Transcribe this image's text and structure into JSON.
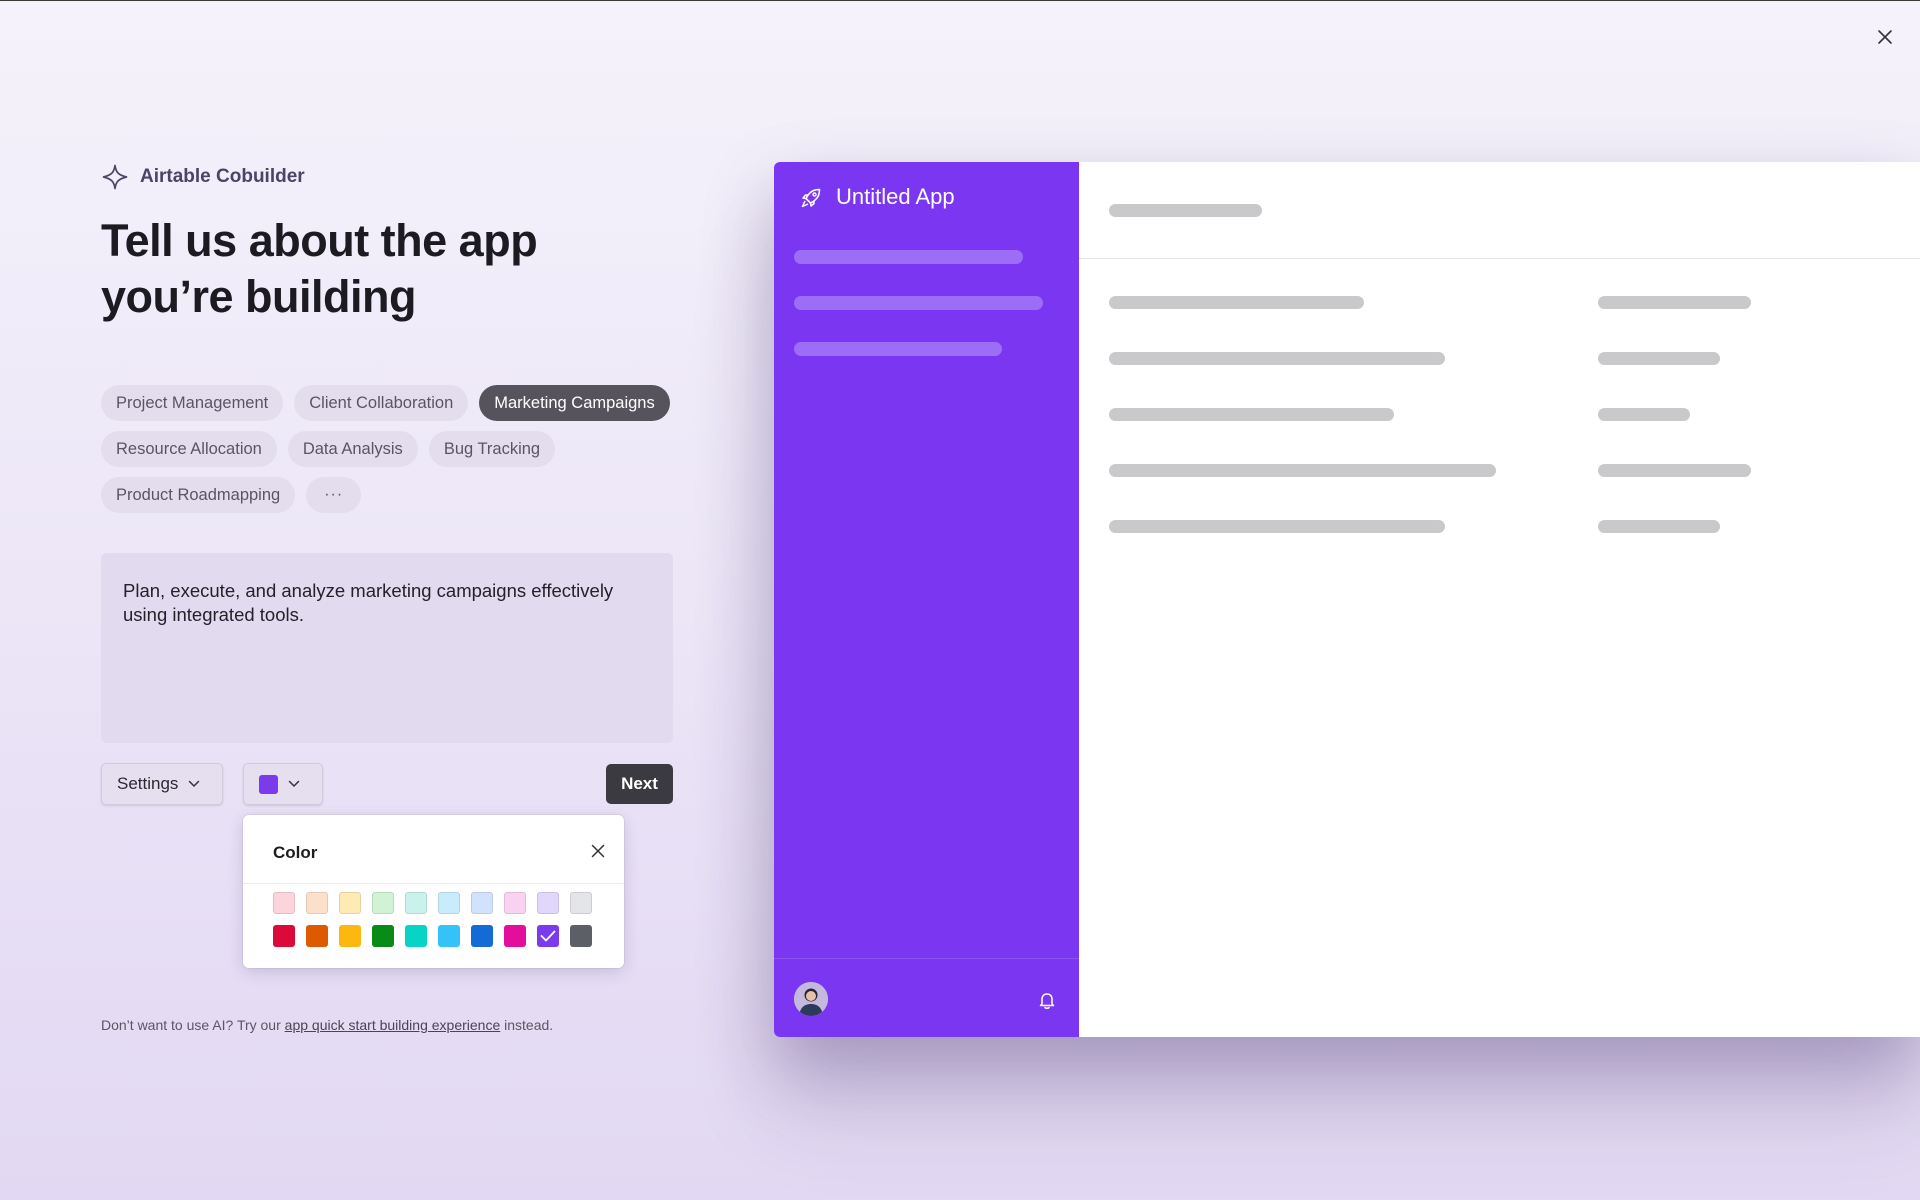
{
  "brand": {
    "label": "Airtable Cobuilder",
    "icon": "sparkle-icon"
  },
  "headline": {
    "line1": "Tell us about the app",
    "line2": "you’re building"
  },
  "chips": [
    {
      "label": "Project Management",
      "selected": false
    },
    {
      "label": "Client Collaboration",
      "selected": false
    },
    {
      "label": "Marketing Campaigns",
      "selected": true
    },
    {
      "label": "Resource Allocation",
      "selected": false
    },
    {
      "label": "Data Analysis",
      "selected": false
    },
    {
      "label": "Bug Tracking",
      "selected": false
    },
    {
      "label": "Product Roadmapping",
      "selected": false
    },
    {
      "label": "···",
      "selected": false
    }
  ],
  "prompt": {
    "value": "Plan, execute, and analyze marketing campaigns effectively using integrated tools."
  },
  "controls": {
    "settings_label": "Settings",
    "selected_color": "#7c3aed",
    "next_label": "Next"
  },
  "color_popover": {
    "title": "Color",
    "light_colors": [
      "#fcd5dc",
      "#fde0cc",
      "#fdeab5",
      "#d1f2d4",
      "#c9f2ec",
      "#c8ecfb",
      "#d3e2fb",
      "#f9d2f1",
      "#e1d6fb",
      "#e4e5e8"
    ],
    "dark_colors": [
      "#dc0a3b",
      "#dd5a00",
      "#fdb80f",
      "#0a8a16",
      "#08d4c6",
      "#33c3f6",
      "#146bd6",
      "#e30e9c",
      "#7c3aed",
      "#5c5f66"
    ],
    "selected": "#7c3aed"
  },
  "footnote": {
    "prefix": "Don’t want to use AI? Try our ",
    "link": "app quick start building experience",
    "suffix": " instead."
  },
  "preview": {
    "app_title": "Untitled App",
    "sidebar_color": "#7b36f2"
  }
}
